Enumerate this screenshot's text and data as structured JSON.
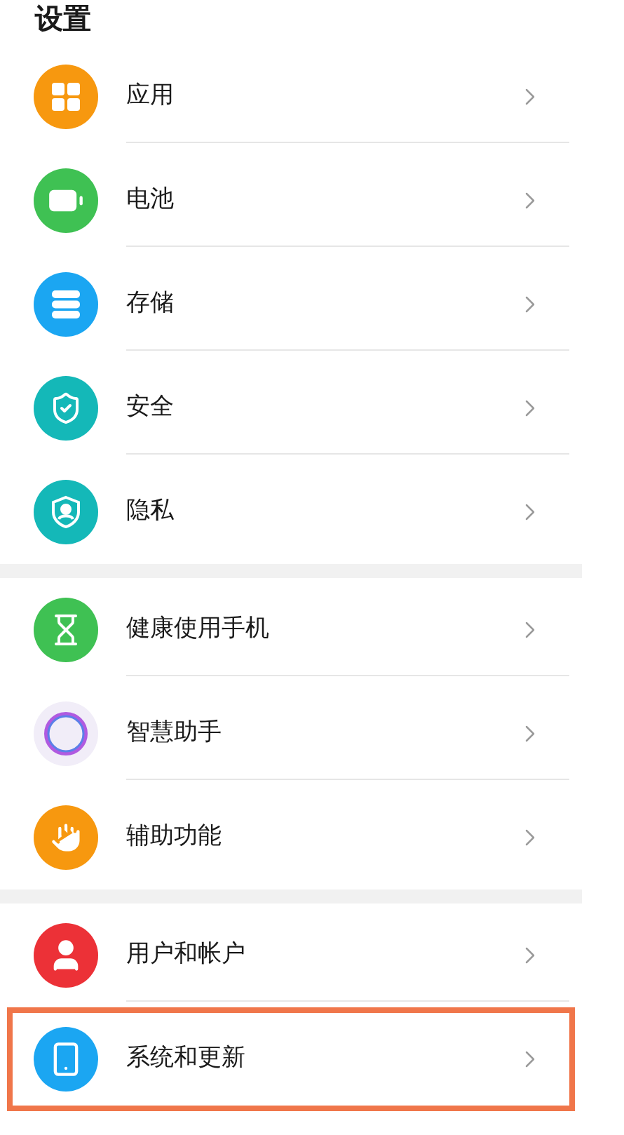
{
  "title": "设置",
  "groups": [
    {
      "items": [
        {
          "label": "应用",
          "color": "#f7980f",
          "highlighted": false
        },
        {
          "label": "电池",
          "color": "#3fc153",
          "highlighted": false
        },
        {
          "label": "存储",
          "color": "#1ba6f2",
          "highlighted": false
        },
        {
          "label": "安全",
          "color": "#14b8b8",
          "highlighted": false
        },
        {
          "label": "隐私",
          "color": "#14b8b8",
          "highlighted": false
        }
      ]
    },
    {
      "items": [
        {
          "label": "健康使用手机",
          "color": "#3fc153",
          "highlighted": false
        },
        {
          "label": "智慧助手",
          "color": "#f1edf8",
          "highlighted": false
        },
        {
          "label": "辅助功能",
          "color": "#f7980f",
          "highlighted": false
        }
      ]
    },
    {
      "items": [
        {
          "label": "用户和帐户",
          "color": "#ec3137",
          "highlighted": false
        },
        {
          "label": "系统和更新",
          "color": "#1ba6f2",
          "highlighted": true
        }
      ]
    }
  ]
}
